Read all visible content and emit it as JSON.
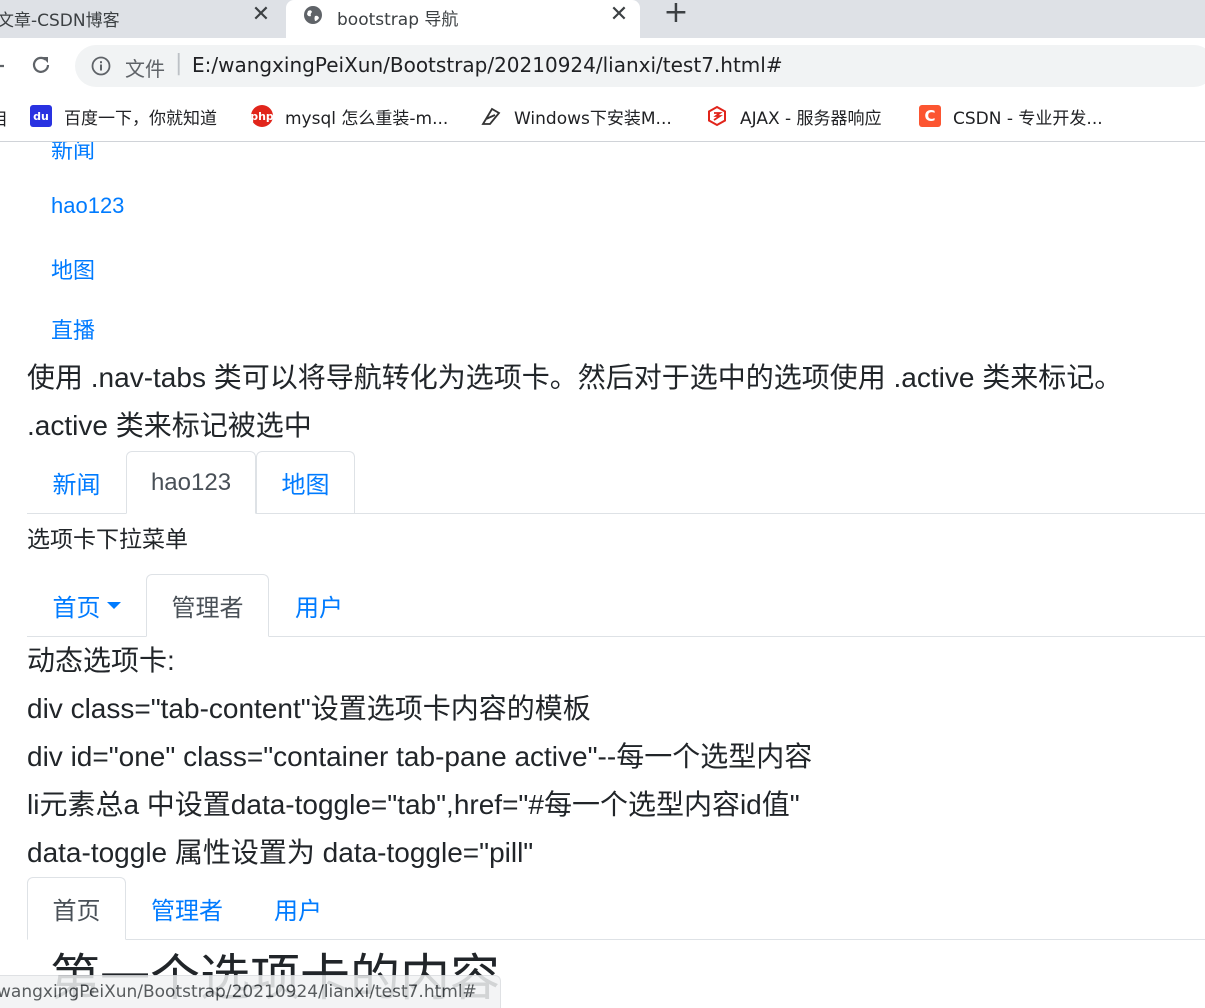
{
  "browser": {
    "tabs": [
      {
        "title": "文章-CSDN博客",
        "active": false
      },
      {
        "title": "bootstrap 导航",
        "active": true
      }
    ],
    "new_tab": "+",
    "close_glyph": "✕",
    "url_prefix": "文件",
    "url": "E:/wangxingPeiXun/Bootstrap/20210924/lianxi/test7.html#",
    "bookmarks": [
      {
        "label": "百度一下，你就知道",
        "icon": "baidu-icon",
        "color": "#2932e1"
      },
      {
        "label": "mysql 怎么重装-m...",
        "icon": "php-icon",
        "color": "#e1251b"
      },
      {
        "label": "Windows下安装M...",
        "icon": "feather-icon",
        "color": "#333333"
      },
      {
        "label": "AJAX - 服务器响应",
        "icon": "w3-icon",
        "color": "#e1251b"
      },
      {
        "label": "CSDN - 专业开发...",
        "icon": "csdn-icon",
        "color": "#fc5531"
      }
    ],
    "bookmark_cut": "目",
    "status_url": "wangxingPeiXun/Bootstrap/20210924/lianxi/test7.html#"
  },
  "content": {
    "vertical_links": [
      "新闻",
      "hao123",
      "地图",
      "直播"
    ],
    "tabs_desc_line1": "使用 .nav-tabs 类可以将导航转化为选项卡。然后对于选中的选项使用 .active 类来标记。",
    "tabs_desc_line2": ".active 类来标记被选中",
    "tabs1": [
      {
        "label": "新闻",
        "active": false
      },
      {
        "label": "hao123",
        "active": true
      },
      {
        "label": "地图",
        "active": false
      }
    ],
    "dropdown_title": "选项卡下拉菜单",
    "tabs2": [
      {
        "label": "首页",
        "active": false,
        "dropdown": true
      },
      {
        "label": "管理者",
        "active": true
      },
      {
        "label": "用户",
        "active": false
      }
    ],
    "dynamic_lines": [
      "动态选项卡:",
      "div class=\"tab-content\"设置选项卡内容的模板",
      "div id=\"one\" class=\"container tab-pane active\"--每一个选型内容",
      "li元素总a 中设置data-toggle=\"tab\",href=\"#每一个选型内容id值\"",
      "data-toggle 属性设置为 data-toggle=\"pill\""
    ],
    "tabs3": [
      {
        "label": "首页",
        "active": true
      },
      {
        "label": "管理者",
        "active": false
      },
      {
        "label": "用户",
        "active": false
      }
    ],
    "tab_content_heading": "第一个选项卡的内容"
  },
  "colors": {
    "link": "#007bff",
    "text": "#212529",
    "tab_border": "#dee2e6",
    "chrome_bg": "#dee1e6"
  }
}
